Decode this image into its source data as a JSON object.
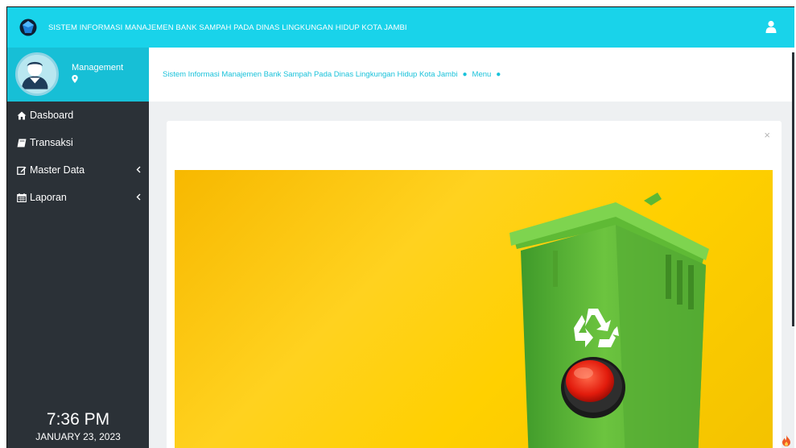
{
  "header": {
    "title": "SISTEM INFORMASI MANAJEMEN BANK SAMPAH PADA DINAS LINGKUNGAN HIDUP KOTA JAMBI",
    "logo_icon": "gem-logo-icon",
    "user_icon": "user-icon"
  },
  "sidebar": {
    "profile": {
      "name": "Management",
      "location_icon": "map-marker-icon"
    },
    "items": [
      {
        "label": "Dasboard",
        "icon": "home-icon",
        "has_submenu": false
      },
      {
        "label": "Transaksi",
        "icon": "book-icon",
        "has_submenu": false
      },
      {
        "label": "Master Data",
        "icon": "edit-icon",
        "has_submenu": true
      },
      {
        "label": "Laporan",
        "icon": "calendar-icon",
        "has_submenu": true
      }
    ],
    "clock": {
      "time": "7:36 PM",
      "date": "JANUARY 23, 2023"
    }
  },
  "breadcrumb": {
    "items": [
      "Sistem Informasi Manajemen Bank Sampah Pada Dinas Lingkungan Hidup Kota Jambi",
      "Menu"
    ]
  },
  "card": {
    "close_label": "×"
  },
  "colors": {
    "topbar": "#19d3ea",
    "sidebar": "#2b3137",
    "profile_bg": "#17bfd6",
    "breadcrumb_text": "#19c2da",
    "banner": "#ffd000"
  }
}
